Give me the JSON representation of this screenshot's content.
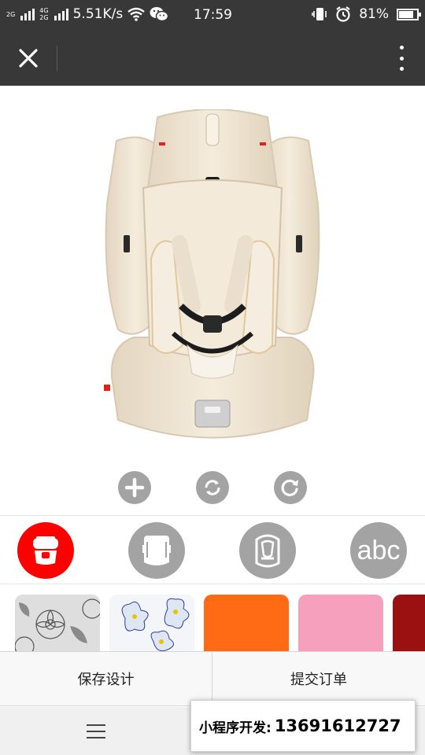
{
  "status_bar": {
    "network_top": "2G",
    "network_mid_top": "4G",
    "network_mid_bottom": "2G",
    "speed": "5.51K/s",
    "time": "17:59",
    "battery": "81%",
    "icons": [
      "signal-icon",
      "wifi-icon",
      "wechat-icon",
      "vibrate-icon",
      "alarm-icon",
      "battery-icon"
    ]
  },
  "title_bar": {
    "close_icon": "close-icon",
    "more_icon": "more-vertical-icon"
  },
  "product": {
    "type": "child car seat",
    "color": "#efe4d2"
  },
  "actions": [
    {
      "name": "add",
      "icon": "plus-icon"
    },
    {
      "name": "reset",
      "icon": "refresh-ring-icon"
    },
    {
      "name": "rotate",
      "icon": "rotate-icon"
    }
  ],
  "tabs": [
    {
      "name": "seat-front",
      "active": true,
      "color": "#ff0000"
    },
    {
      "name": "seat-back",
      "active": false,
      "color": "#a3a3a3"
    },
    {
      "name": "seat-top",
      "active": false,
      "color": "#a3a3a3"
    },
    {
      "name": "text",
      "label": "abc",
      "active": false,
      "color": "#a3a3a3"
    }
  ],
  "swatches": [
    {
      "pattern": "grey floral",
      "color": "#d9d9d9"
    },
    {
      "pattern": "blue floral",
      "color": "#e6ecf4"
    },
    {
      "pattern": "orange",
      "color": "#ff6a14"
    },
    {
      "pattern": "pink",
      "color": "#f7a0bd"
    },
    {
      "pattern": "dark red",
      "color": "#9b1111"
    }
  ],
  "buttons": {
    "save": "保存设计",
    "submit": "提交订单"
  },
  "navbar": {
    "menu_icon": "menu-icon"
  },
  "developer": {
    "label": "小程序开发:",
    "phone": "13691612727"
  }
}
